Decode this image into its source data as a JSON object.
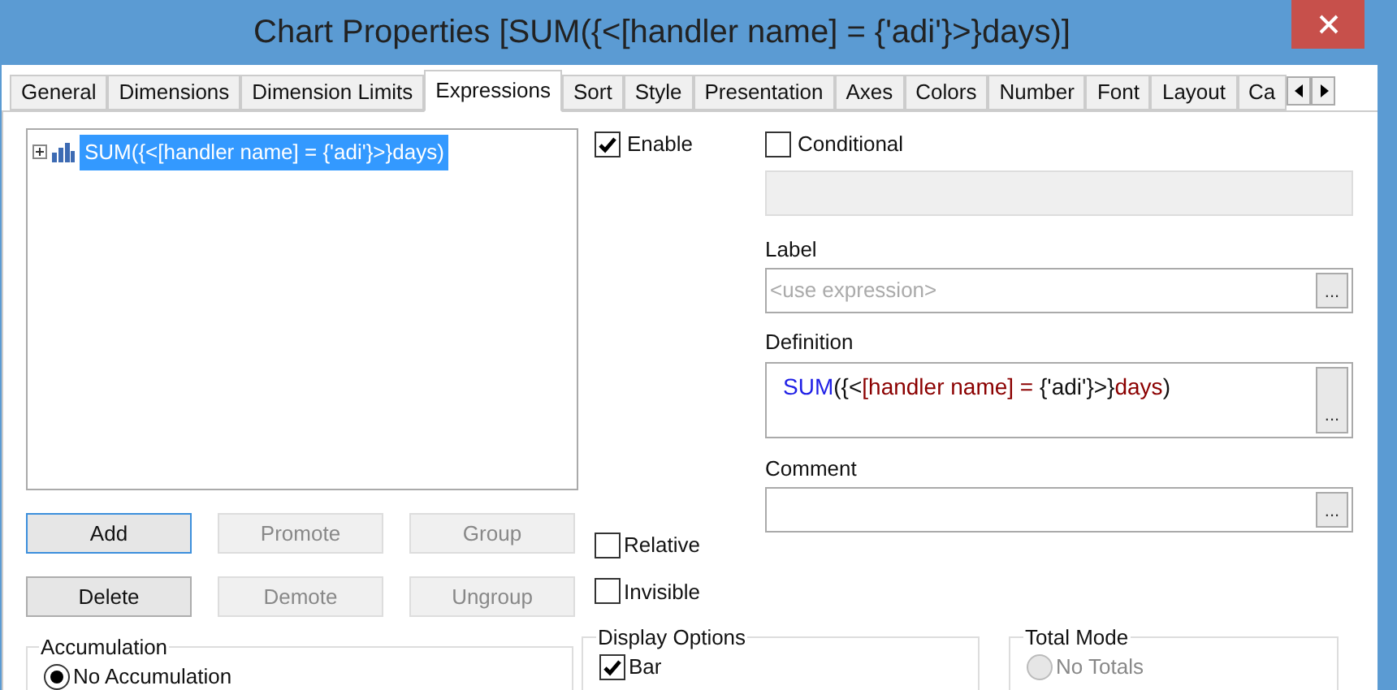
{
  "window": {
    "title": "Chart Properties [SUM({<[handler name] = {'adi'}>}days)]"
  },
  "tabs": [
    {
      "label": "General",
      "selected": false
    },
    {
      "label": "Dimensions",
      "selected": false
    },
    {
      "label": "Dimension Limits",
      "selected": false
    },
    {
      "label": "Expressions",
      "selected": true
    },
    {
      "label": "Sort",
      "selected": false
    },
    {
      "label": "Style",
      "selected": false
    },
    {
      "label": "Presentation",
      "selected": false
    },
    {
      "label": "Axes",
      "selected": false
    },
    {
      "label": "Colors",
      "selected": false
    },
    {
      "label": "Number",
      "selected": false
    },
    {
      "label": "Font",
      "selected": false
    },
    {
      "label": "Layout",
      "selected": false
    },
    {
      "label": "Ca",
      "selected": false
    }
  ],
  "expressions": [
    {
      "label": "SUM({<[handler name] = {'adi'}>}days)",
      "selected": true,
      "expanded": false
    }
  ],
  "buttons": [
    {
      "label": "Add",
      "disabled": false,
      "focused": true
    },
    {
      "label": "Promote",
      "disabled": true,
      "focused": false
    },
    {
      "label": "Group",
      "disabled": true,
      "focused": false
    },
    {
      "label": "Delete",
      "disabled": false,
      "focused": false
    },
    {
      "label": "Demote",
      "disabled": true,
      "focused": false
    },
    {
      "label": "Ungroup",
      "disabled": true,
      "focused": false
    }
  ],
  "accumulation": {
    "title": "Accumulation",
    "options": [
      {
        "label": "No Accumulation",
        "selected": true
      }
    ]
  },
  "enable": {
    "label": "Enable",
    "checked": true
  },
  "conditional": {
    "label": "Conditional",
    "checked": false
  },
  "label_field": {
    "label": "Label",
    "placeholder": "<use expression>",
    "button": "..."
  },
  "definition": {
    "label": "Definition",
    "button": "...",
    "tokens": [
      {
        "text": "SUM",
        "color": "#1f1fe6"
      },
      {
        "text": "({<",
        "color": "#111111"
      },
      {
        "text": "[handler name] = ",
        "color": "#8b0000"
      },
      {
        "text": "{'adi'}>}",
        "color": "#111111"
      },
      {
        "text": "days",
        "color": "#8b0000"
      },
      {
        "text": ")",
        "color": "#111111"
      }
    ]
  },
  "comment": {
    "label": "Comment",
    "button": "..."
  },
  "options": [
    {
      "label": "Relative",
      "checked": false
    },
    {
      "label": "Invisible",
      "checked": false
    }
  ],
  "display_options": {
    "title": "Display Options",
    "items": [
      {
        "label": "Bar",
        "checked": true
      }
    ]
  },
  "total_mode": {
    "title": "Total Mode",
    "options": [
      {
        "label": "No Totals",
        "selected": false,
        "disabled": true
      }
    ]
  }
}
